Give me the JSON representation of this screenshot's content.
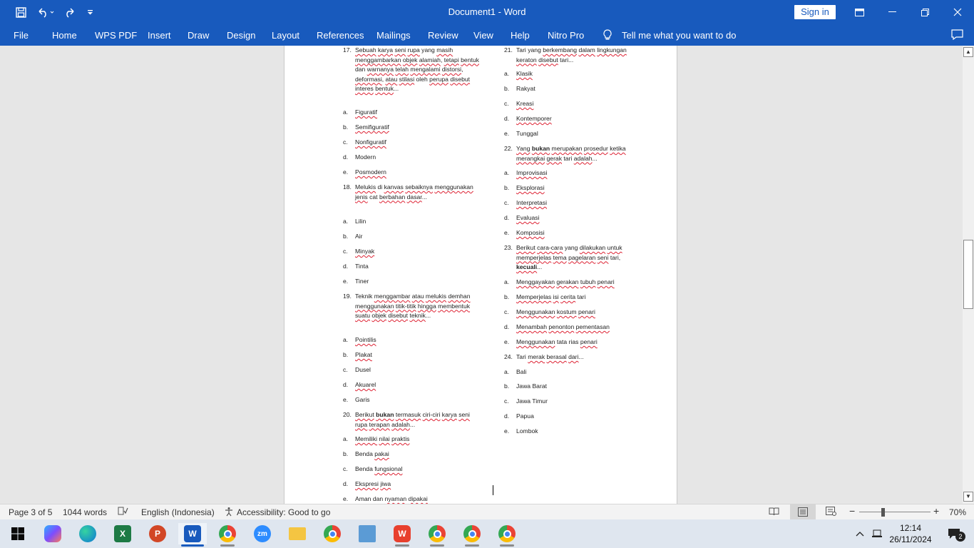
{
  "window": {
    "title": "Document1 - Word",
    "sign_in": "Sign in"
  },
  "ribbon_tabs": [
    "File",
    "Home",
    "WPS PDF",
    "Insert",
    "Draw",
    "Design",
    "Layout",
    "References",
    "Mailings",
    "Review",
    "View",
    "Help",
    "Nitro Pro"
  ],
  "tell_me": "Tell me what you want to do",
  "icons": {
    "save": "save-icon",
    "undo": "undo-icon",
    "redo": "redo-icon",
    "qat": "customize-qat-icon",
    "restore_ribbon": "ribbon-display-icon",
    "minimize": "minimize-icon",
    "maximize": "maximize-icon",
    "close": "close-icon",
    "comments": "comments-icon",
    "lightbulb": "lightbulb-icon"
  },
  "document": {
    "left_column": [
      {
        "label": "17.",
        "text": "Sebuah karya seni rupa yang masih menggambarkan objek alamiah, tetapi bentuk dan warnanya telah mengalami distorsi, deformasi, atau stilasi oleh perupa disebut interes bentuk..."
      },
      {
        "label": "a.",
        "text": "Figuratif"
      },
      {
        "label": "b.",
        "text": "Semifiguratif"
      },
      {
        "label": "c.",
        "text": "Nonfiguratif"
      },
      {
        "label": "d.",
        "text": "Modern"
      },
      {
        "label": "e.",
        "text": "Posmodern"
      },
      {
        "label": "18.",
        "text": "Melukis di kanvas sebaiknya menggunakan jenis cat berbahan dasar..."
      },
      {
        "label": "a.",
        "text": "Lilin"
      },
      {
        "label": "b.",
        "text": "Air"
      },
      {
        "label": "c.",
        "text": "Minyak"
      },
      {
        "label": "d.",
        "text": "Tinta"
      },
      {
        "label": "e.",
        "text": "Tiner"
      },
      {
        "label": "19.",
        "text": "Teknik menggambar atau melukis demhan menggunakan titik-titik hingga membentuk suatu objek disebut teknik..."
      },
      {
        "label": "a.",
        "text": "Pointilis"
      },
      {
        "label": "b.",
        "text": "Plakat"
      },
      {
        "label": "c.",
        "text": "Dusel"
      },
      {
        "label": "d.",
        "text": "Akuarel"
      },
      {
        "label": "e.",
        "text": "Garis"
      },
      {
        "label": "20.",
        "text": "Berikut bukan termasuk ciri-ciri karya seni rupa terapan adalah..."
      },
      {
        "label": "a.",
        "text": "Memiliki nilai praktis"
      },
      {
        "label": "b.",
        "text": "Benda pakai"
      },
      {
        "label": "c.",
        "text": "Benda fungsional"
      },
      {
        "label": "d.",
        "text": "Ekspresi jiwa"
      },
      {
        "label": "e.",
        "text": "Aman dan nyaman dipakai"
      }
    ],
    "right_column": [
      {
        "label": "21.",
        "text": "Tari yang berkembang dalam lingkungan keraton disebut tari..."
      },
      {
        "label": "a.",
        "text": "Klasik"
      },
      {
        "label": "b.",
        "text": "Rakyat"
      },
      {
        "label": "c.",
        "text": "Kreasi"
      },
      {
        "label": "d.",
        "text": "Kontemporer"
      },
      {
        "label": "e.",
        "text": "Tunggal"
      },
      {
        "label": "22.",
        "text": "Yang bukan merupakan prosedur ketika merangkai gerak tari adalah..."
      },
      {
        "label": "a.",
        "text": "Improvisasi"
      },
      {
        "label": "b.",
        "text": "Eksplorasi"
      },
      {
        "label": "c.",
        "text": "Interpretasi"
      },
      {
        "label": "d.",
        "text": "Evaluasi"
      },
      {
        "label": "e.",
        "text": "Komposisi"
      },
      {
        "label": "23.",
        "text": "Berikut cara-cara yang dilakukan untuk memperjelas tema pagelaran seni tari, kecuali..."
      },
      {
        "label": "a.",
        "text": "Menggayakan gerakan tubuh penari"
      },
      {
        "label": "b.",
        "text": "Memperjelas isi cerita tari"
      },
      {
        "label": "c.",
        "text": "Menggunakan kostum penari"
      },
      {
        "label": "d.",
        "text": "Menambah penonton pementasan"
      },
      {
        "label": "e.",
        "text": "Menggunakan tata rias penari"
      },
      {
        "label": "24.",
        "text": "Tari merak berasal dari..."
      },
      {
        "label": "a.",
        "text": "Bali"
      },
      {
        "label": "b.",
        "text": "Jawa Barat"
      },
      {
        "label": "c.",
        "text": "Jawa Timur"
      },
      {
        "label": "d.",
        "text": "Papua"
      },
      {
        "label": "e.",
        "text": "Lombok"
      }
    ]
  },
  "status": {
    "page": "Page 3 of 5",
    "words": "1044 words",
    "language": "English (Indonesia)",
    "accessibility": "Accessibility: Good to go",
    "zoom": "70%",
    "zoom_minus": "−",
    "zoom_plus": "+"
  },
  "taskbar": {
    "apps": [
      "windows-start",
      "copilot",
      "edge",
      "excel",
      "powerpoint",
      "word",
      "chrome-profile-d",
      "zoom",
      "file-explorer",
      "chrome",
      "control-panel",
      "wps-office",
      "chrome-profile-2",
      "chrome-profile-3",
      "chrome-profile-4"
    ],
    "zoom_label": "zm",
    "time": "12:14",
    "date": "26/11/2024",
    "notifications": "2"
  },
  "colors": {
    "word_blue": "#185abd",
    "squiggle": "#dd2233",
    "taskbar": "#dfe6ef"
  }
}
